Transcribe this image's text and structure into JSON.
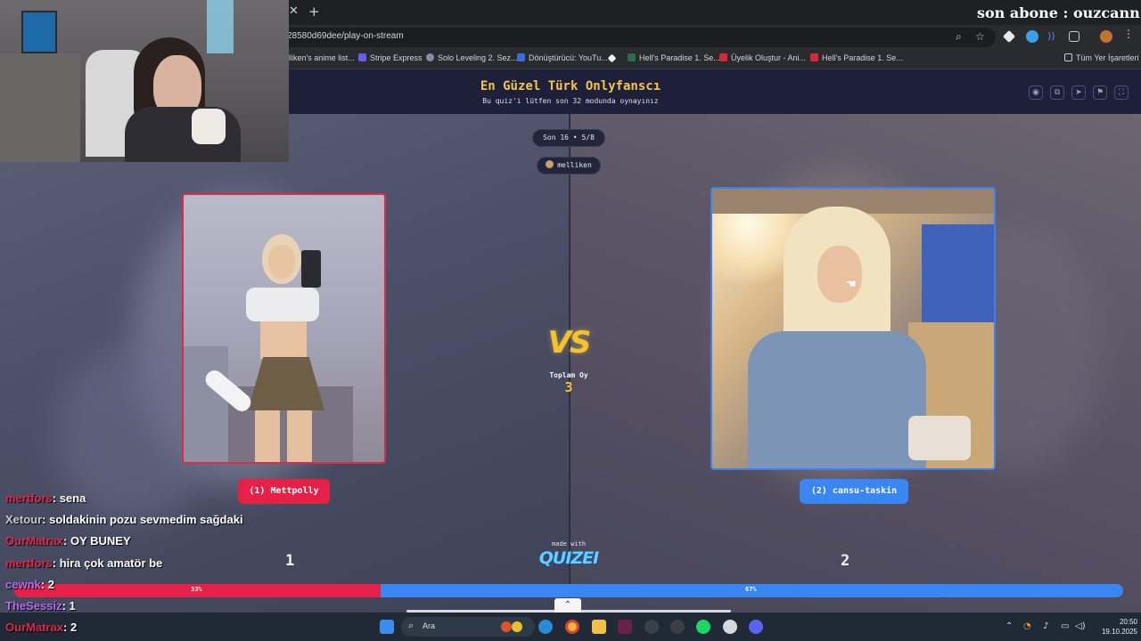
{
  "browser": {
    "url": "28580d69dee/play-on-stream",
    "bookmarks": [
      {
        "label": "elliken's anime list..."
      },
      {
        "label": "Stripe Express"
      },
      {
        "label": "Solo Leveling 2. Sez..."
      },
      {
        "label": "Dönüştürücü: YouTu..."
      },
      {
        "label": ""
      },
      {
        "label": "Hell's Paradise 1. Se..."
      },
      {
        "label": "Üyelik Oluştur - Ani..."
      },
      {
        "label": "Hell's Paradise 1. Se..."
      }
    ],
    "all_bookmarks_label": "Tüm Yer İşaretleri"
  },
  "quiz": {
    "title": "En Güzel Türk Onlyfanscı",
    "subtitle": "Bu quiz'i lütfen son 32 modunda oynayınız",
    "round": "Son 16 • 5/8",
    "user": "melliken",
    "left": {
      "label": "(1) Mettpolly",
      "votes": "1",
      "percent": 33,
      "percent_label": "33%",
      "color": "#e62148"
    },
    "right": {
      "label": "(2) cansu-taskin",
      "votes": "2",
      "percent": 67,
      "percent_label": "67%",
      "color": "#3a86f3"
    },
    "vs": "VS",
    "total_label": "Toplam Oy",
    "total_value": "3",
    "made_with": "made with",
    "brand": "QUIZEI"
  },
  "stream": {
    "overlay_text": "son abone : ouzcann",
    "chat": [
      {
        "user": "mertfors",
        "message": ": sena",
        "color": "#e0294a"
      },
      {
        "user": "Xetour",
        "message": ": soldakinin pozu sevmedim sağdaki",
        "color": "#c9c9c9"
      },
      {
        "user": "OurMatrax",
        "message": ": OY BUNEY",
        "color": "#e0294a"
      },
      {
        "user": "mertfors",
        "message": ": hira çok amatör be",
        "color": "#e0294a"
      },
      {
        "user": "cewnk",
        "message": ": 2",
        "color": "#b46cf0"
      },
      {
        "user": "TheSessiz",
        "message": ": 1",
        "color": "#b46cf0"
      },
      {
        "user": "OurMatrax",
        "message": ": 2",
        "color": "#e0294a"
      }
    ]
  },
  "taskbar": {
    "search_placeholder": "Ara",
    "time": "20:50",
    "date": "19.10.2025"
  }
}
